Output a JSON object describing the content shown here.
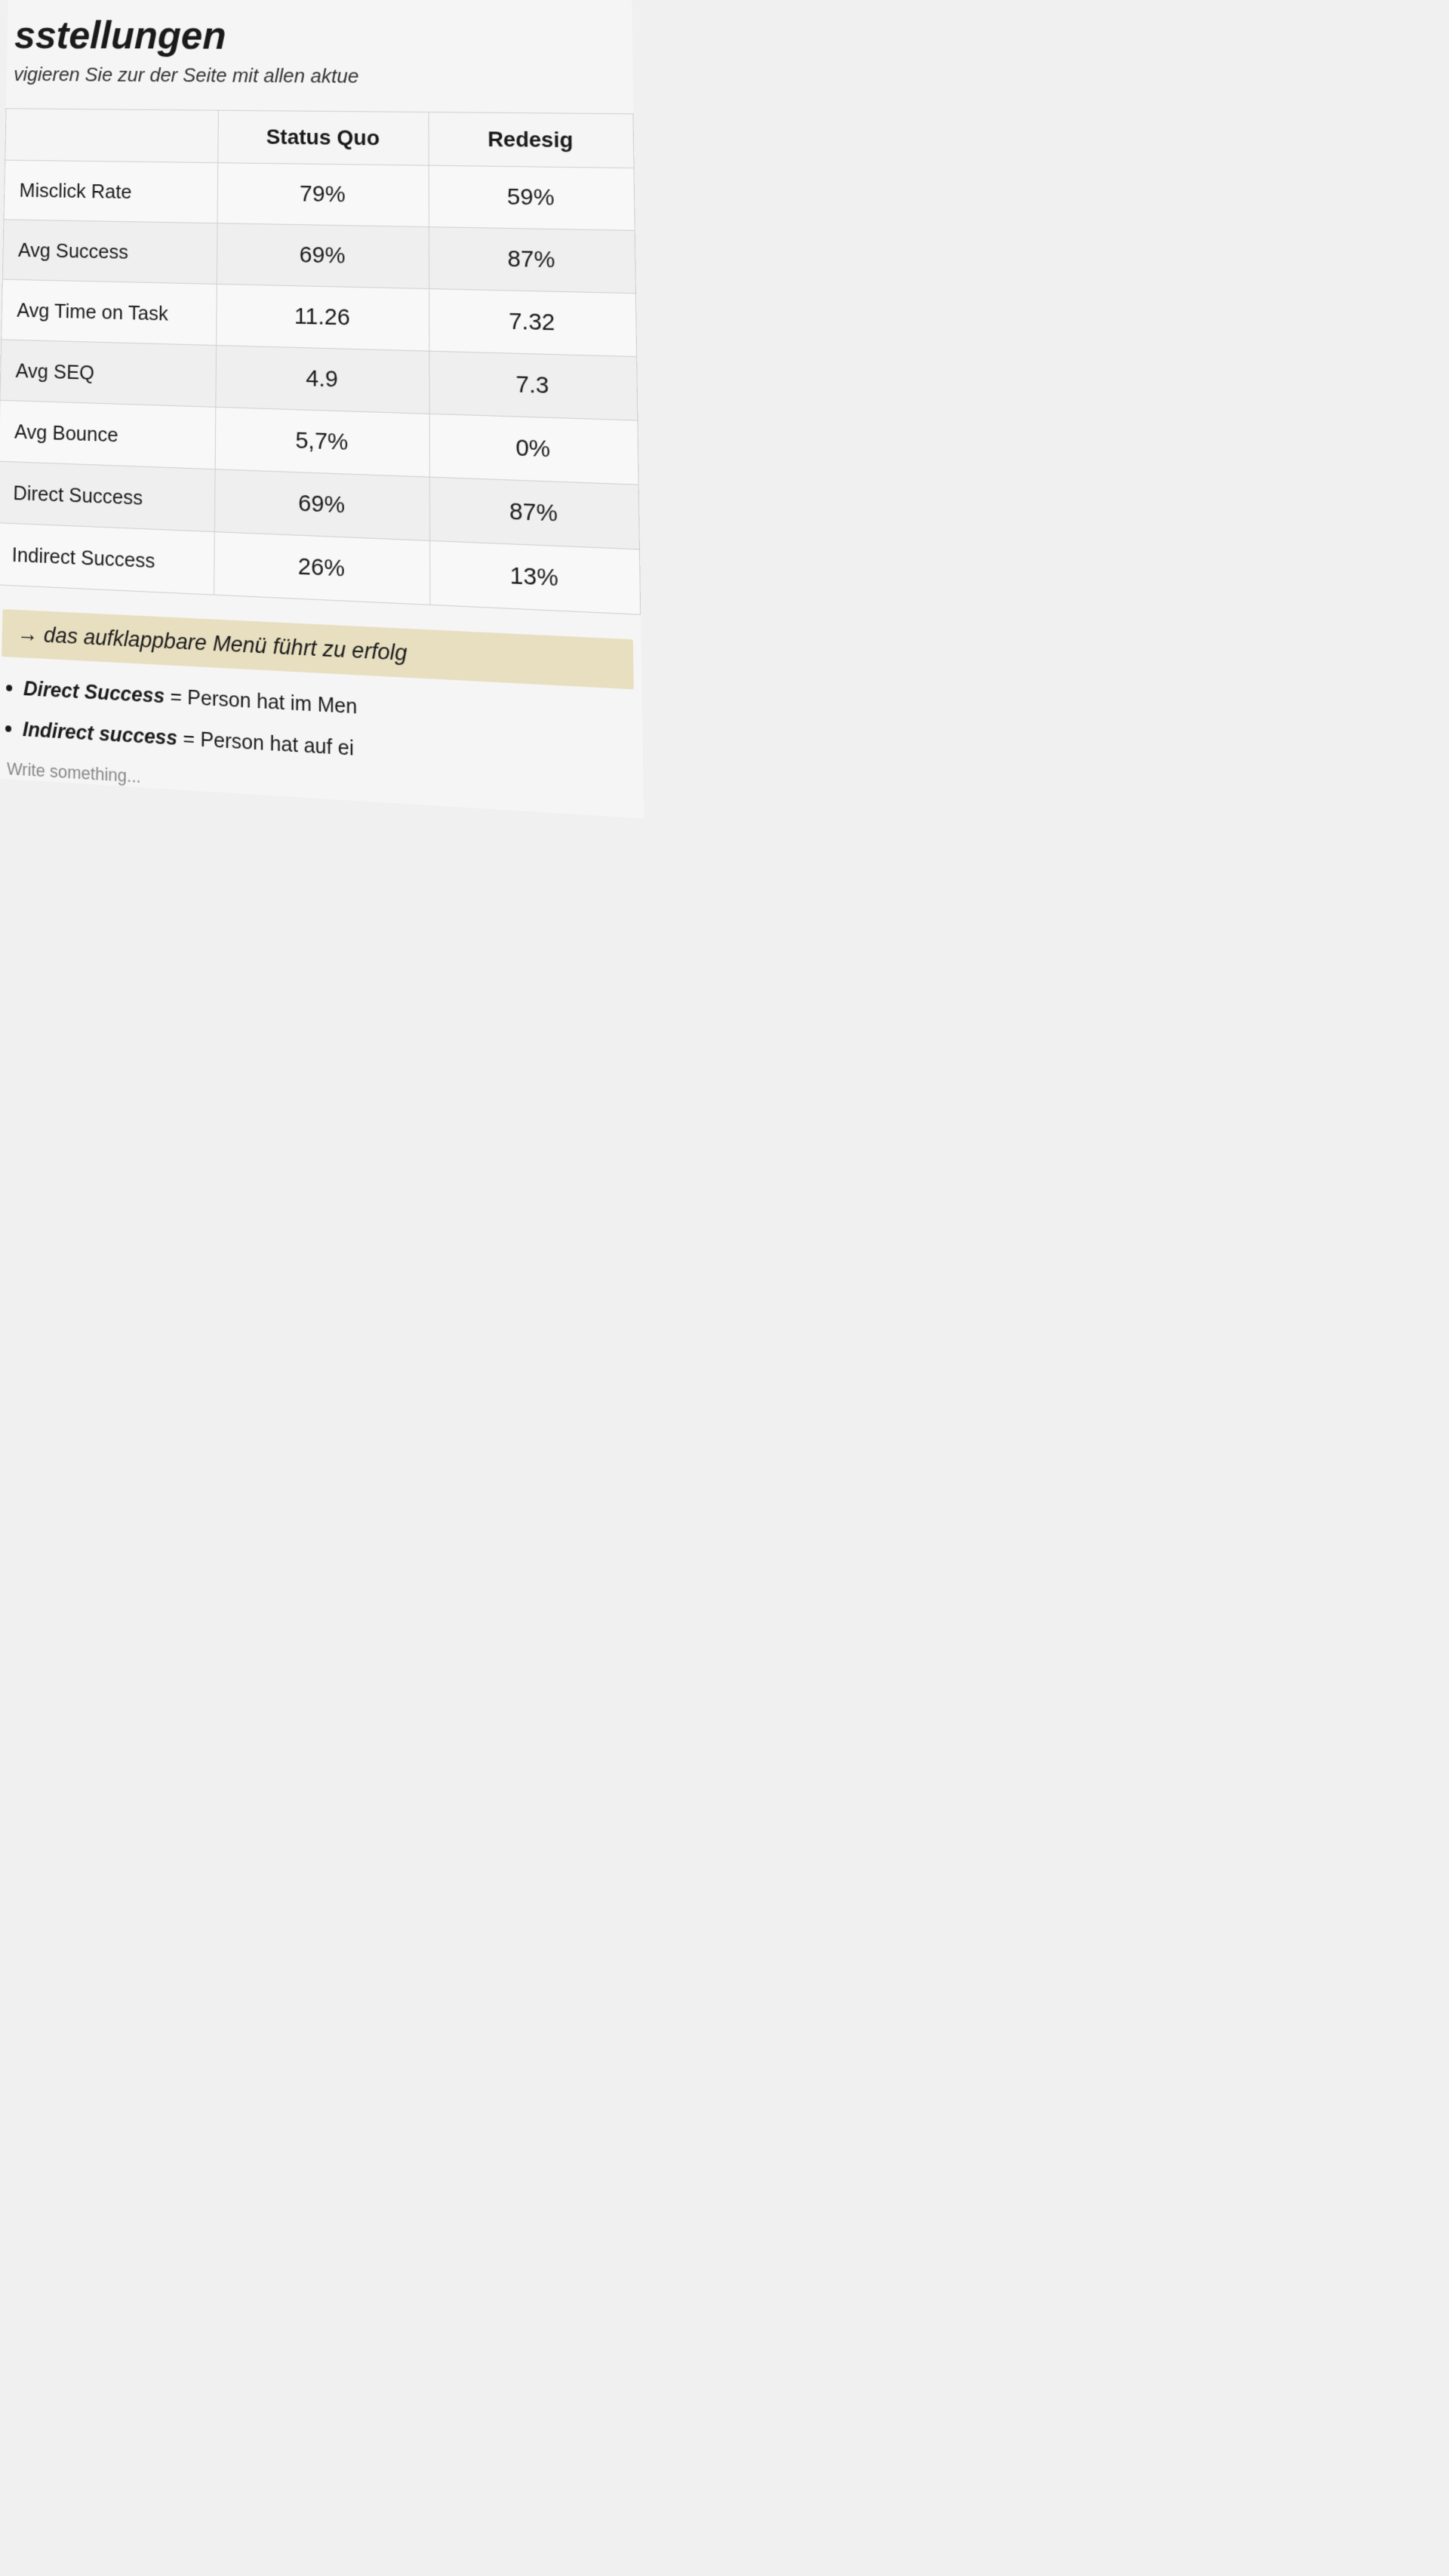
{
  "page": {
    "title": "sstellungen",
    "subtitle": "vigieren Sie zur der Seite mit allen aktue",
    "table": {
      "headers": [
        "",
        "Status Quo",
        "Redesig"
      ],
      "rows": [
        {
          "metric": "Misclick Rate",
          "status_quo": "79%",
          "redesign": "59%"
        },
        {
          "metric": "Avg Success",
          "status_quo": "69%",
          "redesign": "87%"
        },
        {
          "metric": "Avg Time on Task",
          "status_quo": "11.26",
          "redesign": "7.32"
        },
        {
          "metric": "Avg SEQ",
          "status_quo": "4.9",
          "redesign": "7.3"
        },
        {
          "metric": "Avg Bounce",
          "status_quo": "5,7%",
          "redesign": "0%"
        },
        {
          "metric": "Direct Success",
          "status_quo": "69%",
          "redesign": "87%"
        },
        {
          "metric": "Indirect Success",
          "status_quo": "26%",
          "redesign": "13%"
        }
      ]
    },
    "highlight_text": "→ das aufklappbare Menü führt zu erfolg",
    "bullet_items": [
      {
        "bold": "Direct Success",
        "rest": " = Person hat im Men"
      },
      {
        "bold": "Indirect success",
        "rest": " = Person hat auf ei"
      }
    ],
    "write_something": "Write something..."
  }
}
